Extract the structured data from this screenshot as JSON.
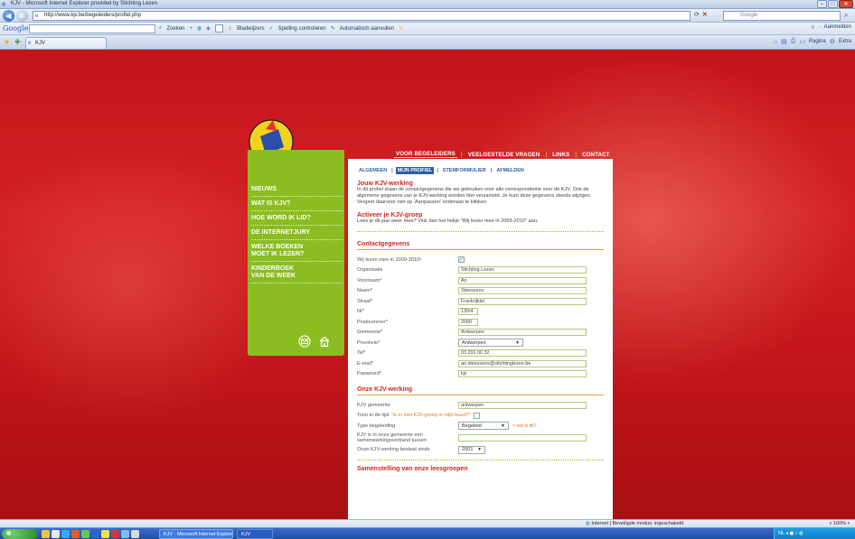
{
  "browser": {
    "title": "KJV - Microsoft Internet Explorer provided by Stichting Lezen",
    "url": "http://www.kjv.be/begeleiders/profiel.php",
    "search_placeholder": "Google",
    "toolbar_logo": "Google",
    "toolbar_items": [
      "Zoeken",
      "Bladwijzers",
      "Spelling controleren",
      "Automatisch aanvullen"
    ],
    "toolbar_right": "Aanmelden",
    "tab_label": "KJV",
    "command_items": [
      "Pagina",
      "Extra"
    ],
    "status_zone": "Internet | Beveiligde modus: ingeschakeld",
    "zoom": "100%"
  },
  "site": {
    "logo_text": "KINDER- EN JEUGDJURY",
    "topnav": [
      {
        "label": "VOOR BEGELEIDERS",
        "active": true
      },
      {
        "label": "VEELGESTELDE VRAGEN",
        "active": false
      },
      {
        "label": "LINKS",
        "active": false
      },
      {
        "label": "CONTACT",
        "active": false
      }
    ],
    "sidebar": [
      "NIEUWS",
      "WAT IS KJV?",
      "HOE WORD IK LID?",
      "DE INTERNETJURY",
      "WELKE BOEKEN\nMOET IK LEZEN?",
      "KINDERBOEK\nVAN DE WEEK"
    ],
    "subnav": [
      "ALGEMEEN",
      "MIJN PROFIEL",
      "STEMFORMULIER",
      "AFMELDEN"
    ],
    "section1_title": "Jouw KJV-werking",
    "section1_text": "In dit profiel staan de contactgegevens die we gebruiken voor alle correspondentie over de KJV. Ook de algemene gegevens van je KJV-werking worden hier verzameld. Je kunt deze gegevens steeds wijzigen. Vergeet daarvoor niet op 'Aanpassen' onderaan te klikken.",
    "section2_title": "Activeer je KJV-groep",
    "section2_text": "Lees je dit jaar weer mee? Vink dan het hokje \"Wij lezen mee in 2009-2010\" aan.",
    "contact_title": "Contactgegevens",
    "contact": {
      "participate_label": "Wij lezen mee in 2009-2010!",
      "organisatie_label": "Organisatie",
      "organisatie": "Stichting Lezen",
      "voornaam_label": "Voornaam*",
      "voornaam": "An",
      "naam_label": "Naam*",
      "naam": "Steessens",
      "straat_label": "Straat*",
      "straat": "Frankrijklei",
      "nr_label": "Nr*",
      "nr": "130/4",
      "postnummer_label": "Postnummer*",
      "postnummer": "2000",
      "gemeente_label": "Gemeente*",
      "gemeente": "Antwerpen",
      "provincie_label": "Provincie*",
      "provincie": "Antwerpen",
      "tel_label": "Tel*",
      "tel": "03 201 00 32",
      "email_label": "E-mail*",
      "email": "an.steessens@stichtinglezen.be",
      "password_label": "Paswoord*",
      "password": "kjv"
    },
    "werking_title": "Onze KJV-werking",
    "werking": {
      "gemeente_label": "KJV gemeente",
      "gemeente": "antwerpen",
      "toon_label": "Toon in de lijst",
      "toon_link": "\"Is er een KJV-groep in mijn buurt?\"",
      "type_label": "Type begeleiding",
      "type": "Begeleid",
      "wat_link": "> wat is dit?",
      "samenwerking_label": "KJV is in onze gemeente een samenwerkingsverband tussen",
      "sinds_label": "Onze KJV-werking bestaat sinds",
      "sinds": "2001"
    },
    "section_cut_title": "Samenstelling van onze leesgroepen"
  },
  "colors": {
    "background_red": "#c4141a",
    "sidebar_green": "#8bbd22",
    "heading_red": "#d0271f",
    "link_blue": "#2d5fa8"
  }
}
